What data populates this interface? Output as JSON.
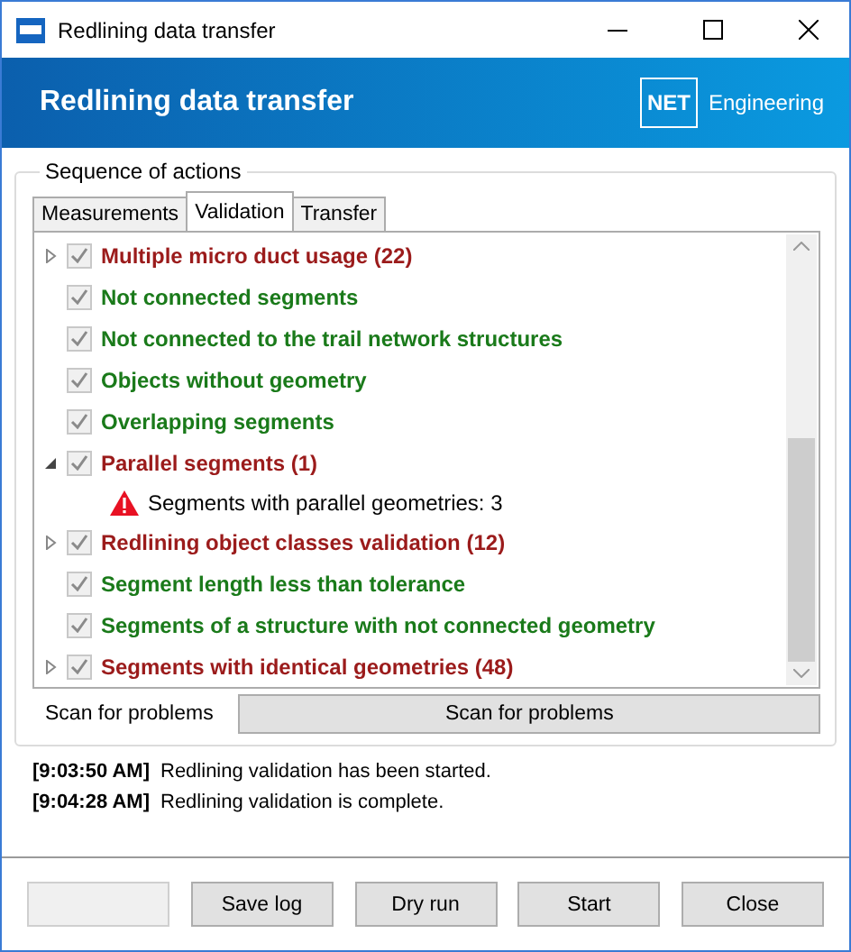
{
  "window": {
    "title": "Redlining data transfer"
  },
  "banner": {
    "title": "Redlining data transfer",
    "logo_text": "NET",
    "company": "Engineering"
  },
  "group": {
    "title": "Sequence of actions"
  },
  "tabs": [
    {
      "label": "Measurements",
      "selected": false
    },
    {
      "label": "Validation",
      "selected": true
    },
    {
      "label": "Transfer",
      "selected": false
    }
  ],
  "checks": [
    {
      "kind": "group",
      "label": "Multiple micro duct usage (22)",
      "color": "#9b1b1b",
      "checked": true,
      "expanded": false
    },
    {
      "kind": "check",
      "label": "Not connected segments",
      "color": "#1a7a1a",
      "checked": true
    },
    {
      "kind": "check",
      "label": "Not connected to the trail network structures",
      "color": "#1a7a1a",
      "checked": true
    },
    {
      "kind": "check",
      "label": "Objects without geometry",
      "color": "#1a7a1a",
      "checked": true
    },
    {
      "kind": "check",
      "label": "Overlapping segments",
      "color": "#1a7a1a",
      "checked": true
    },
    {
      "kind": "group",
      "label": "Parallel segments (1)",
      "color": "#9b1b1b",
      "checked": true,
      "expanded": true,
      "children": [
        {
          "label": "Segments with parallel geometries: 3"
        }
      ]
    },
    {
      "kind": "group",
      "label": "Redlining object classes validation (12)",
      "color": "#9b1b1b",
      "checked": true,
      "expanded": false
    },
    {
      "kind": "check",
      "label": "Segment length less than tolerance",
      "color": "#1a7a1a",
      "checked": true
    },
    {
      "kind": "check",
      "label": "Segments of a structure with not connected geometry",
      "color": "#1a7a1a",
      "checked": true
    },
    {
      "kind": "group",
      "label": "Segments with identical geometries (48)",
      "color": "#9b1b1b",
      "checked": true,
      "expanded": false
    }
  ],
  "scan": {
    "label": "Scan for problems",
    "button": "Scan for problems"
  },
  "log": [
    {
      "time": "[9:03:50 AM]",
      "message": "Redlining validation has been started."
    },
    {
      "time": "[9:04:28 AM]",
      "message": "Redlining validation is complete."
    }
  ],
  "buttons": [
    {
      "disabled": true
    },
    {
      "label": "Save log",
      "disabled": false
    },
    {
      "label": "Dry run",
      "disabled": false
    },
    {
      "label": "Start",
      "disabled": false
    },
    {
      "label": "Close",
      "disabled": false
    }
  ]
}
